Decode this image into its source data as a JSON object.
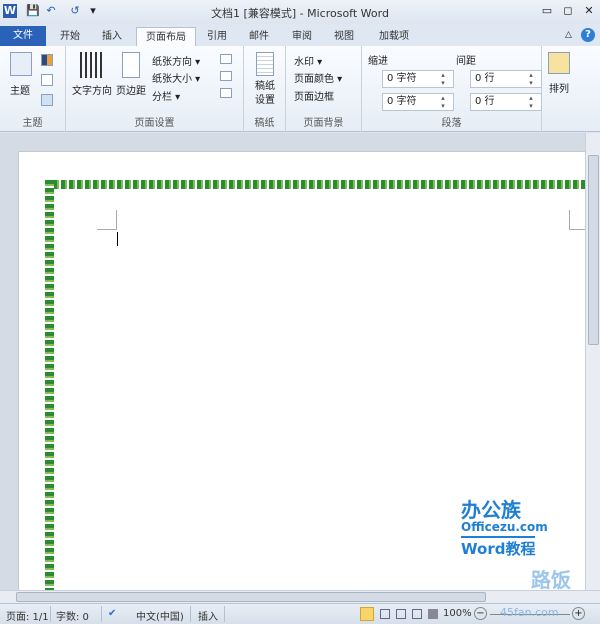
{
  "window": {
    "title": "文档1 [兼容模式] - Microsoft Word"
  },
  "quick_access": {
    "word": "W",
    "save": "💾",
    "undo": "↶",
    "redo": "↺",
    "customize": "▾"
  },
  "controls": {
    "minimize": "▭",
    "restore": "◻",
    "close": "✕",
    "collapse": "△",
    "help": "?"
  },
  "tabs": {
    "file": "文件",
    "items": [
      "开始",
      "插入",
      "页面布局",
      "引用",
      "邮件",
      "审阅",
      "视图",
      "加载项"
    ]
  },
  "ribbon": {
    "themes": {
      "label": "主题",
      "theme": "主题"
    },
    "page_setup": {
      "label": "页面设置",
      "text_direction": "文字方向",
      "margins": "页边距",
      "orientation": "纸张方向 ▾",
      "size": "纸张大小 ▾",
      "columns": "分栏 ▾"
    },
    "manuscript": {
      "label": "稿纸",
      "setup": "稿纸设置"
    },
    "background": {
      "label": "页面背景",
      "watermark": "水印 ▾",
      "page_color": "页面颜色 ▾",
      "page_borders": "页面边框"
    },
    "paragraph": {
      "label": "段落",
      "indent": "缩进",
      "spacing": "间距",
      "indent_left": "0 字符",
      "indent_right": "0 字符",
      "space_before": "0 行",
      "space_after": "0 行"
    },
    "arrange": {
      "label": "排列"
    }
  },
  "watermarks": {
    "brand1": "办公族",
    "brand1_url": "Officezu.com",
    "brand1_sub": "Word教程",
    "brand2": "路饭网",
    "brand2_url": "45fan.com"
  },
  "status": {
    "page": "页面: 1/1",
    "words": "字数: 0",
    "language": "中文(中国)",
    "mode": "插入",
    "zoom": "100%"
  }
}
